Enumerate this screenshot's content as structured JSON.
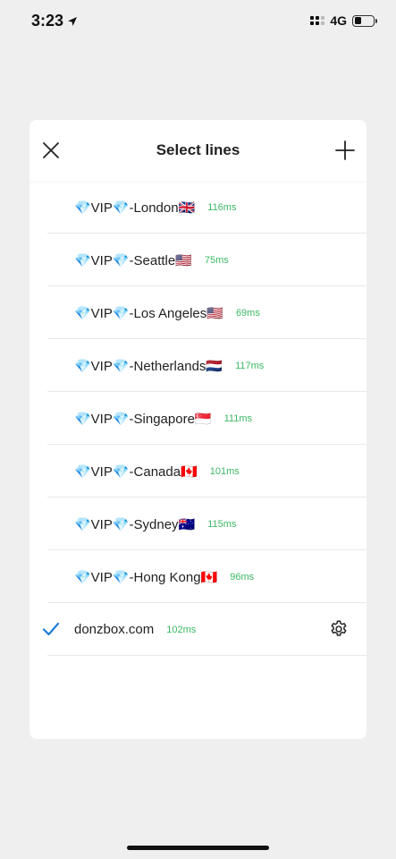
{
  "status_bar": {
    "time": "3:23",
    "network": "4G"
  },
  "dialog": {
    "title": "Select lines"
  },
  "lines": [
    {
      "name": "💎VIP💎-London🇬🇧",
      "ping": "116ms"
    },
    {
      "name": "💎VIP💎-Seattle🇺🇸",
      "ping": "75ms"
    },
    {
      "name": "💎VIP💎-Los Angeles🇺🇸",
      "ping": "69ms"
    },
    {
      "name": "💎VIP💎-Netherlands🇳🇱",
      "ping": "117ms"
    },
    {
      "name": "💎VIP💎-Singapore🇸🇬",
      "ping": "111ms"
    },
    {
      "name": "💎VIP💎-Canada🇨🇦",
      "ping": "101ms"
    },
    {
      "name": "💎VIP💎-Sydney🇦🇺",
      "ping": "115ms"
    },
    {
      "name": "💎VIP💎-Hong Kong🇨🇦",
      "ping": "96ms"
    }
  ],
  "custom_line": {
    "name": "donzbox.com",
    "ping": "102ms",
    "selected": true
  },
  "icons": {
    "close": "close-icon",
    "add": "plus-icon",
    "check": "checkmark-icon",
    "settings": "gear-icon",
    "location": "location-arrow-icon"
  },
  "colors": {
    "ping": "#3cb864",
    "check": "#1e7ed8",
    "background": "#efefef"
  }
}
